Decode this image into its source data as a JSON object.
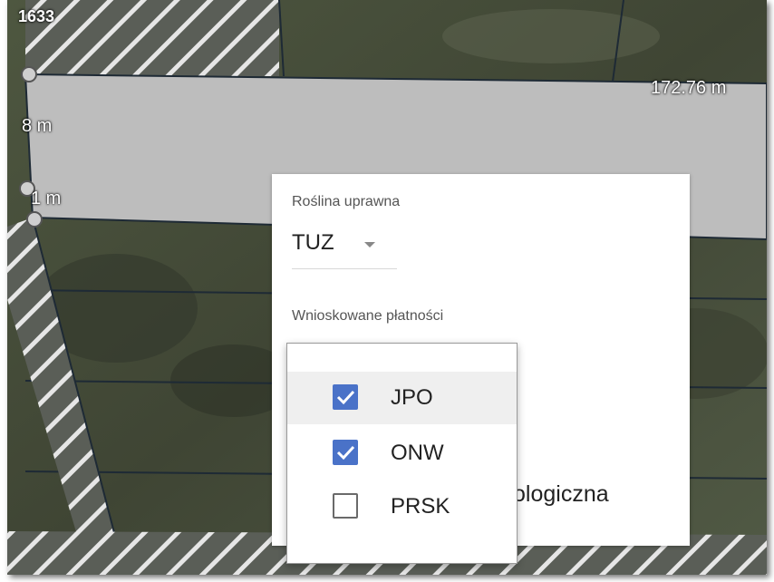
{
  "map": {
    "parcel_label": "1633",
    "measure_top": "172.76 m",
    "measure_left_1": "8 m",
    "measure_left_2": "1 m"
  },
  "panel": {
    "crop_label": "Roślina uprawna",
    "crop_value": "TUZ",
    "payments_label": "Wnioskowane płatności",
    "hidden_text_suffix": "ologiczna"
  },
  "dropdown": {
    "options": [
      {
        "label": "JPO",
        "checked": true,
        "hovered": true
      },
      {
        "label": "ONW",
        "checked": true,
        "hovered": false
      },
      {
        "label": "PRSK",
        "checked": false,
        "hovered": false
      }
    ]
  },
  "colors": {
    "checkbox_checked": "#4a72c8",
    "hover_bg": "#efefef",
    "parcel_fill": "#bdbdbd"
  }
}
